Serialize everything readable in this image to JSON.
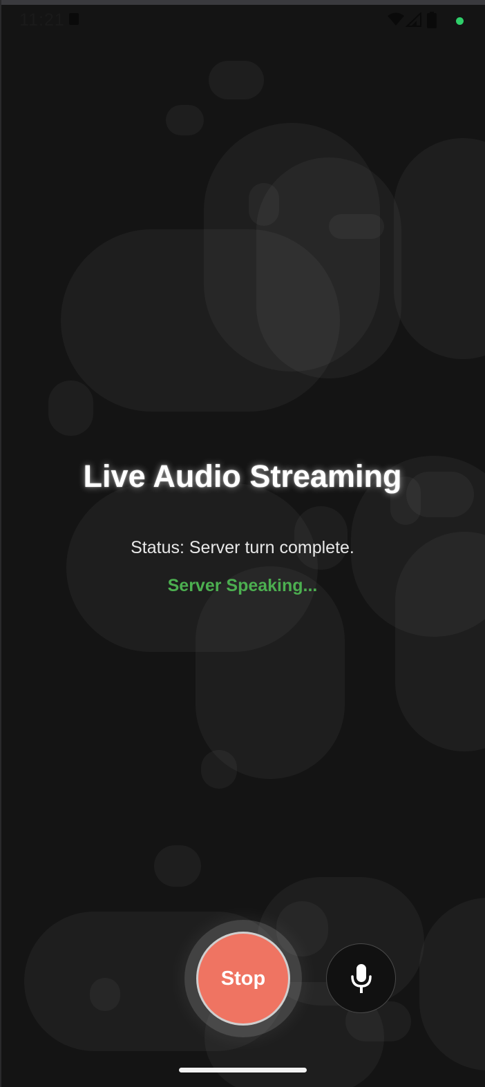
{
  "status_bar": {
    "time": "11:21",
    "icons": [
      "notification-a-icon",
      "wifi-icon",
      "signal-icon",
      "battery-icon",
      "active-dot-icon"
    ],
    "dot_color": "#2fcf6a"
  },
  "main": {
    "title": "Live Audio Streaming",
    "status": "Status: Server turn complete.",
    "speaking_indicator": "Server Speaking...",
    "speaking_color": "#4caf50"
  },
  "controls": {
    "stop_label": "Stop",
    "stop_color": "#ef7462",
    "mic_icon": "microphone-icon"
  },
  "colors": {
    "background": "#141414",
    "text": "#ffffff"
  }
}
